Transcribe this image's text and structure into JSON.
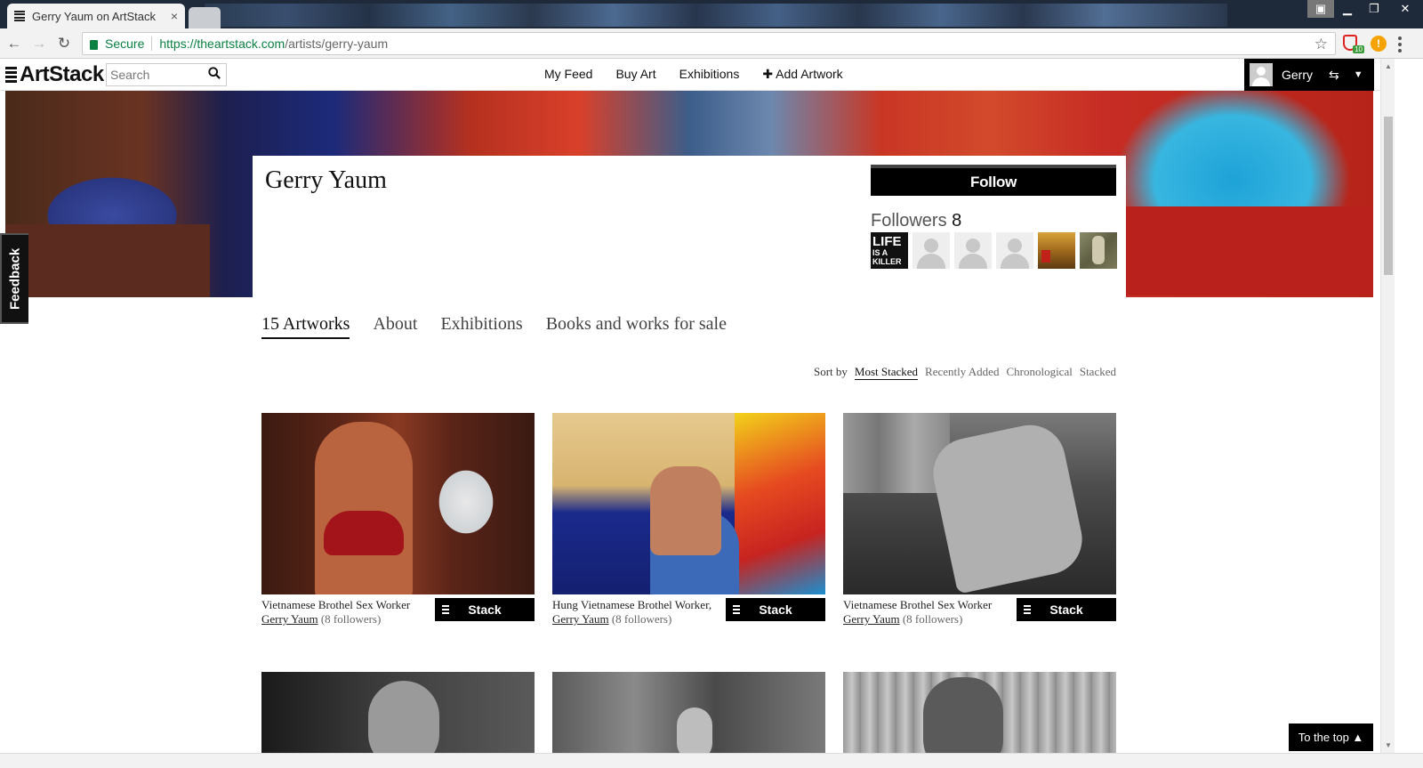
{
  "browser": {
    "tab_title": "Gerry Yaum on ArtStack",
    "tab_close": "×",
    "secure_label": "Secure",
    "url_host": "https://theartstack.com",
    "url_path": "/artists/gerry-yaum",
    "extension_badge": "10",
    "extension_alert": "!"
  },
  "site": {
    "logo": "ArtStack",
    "search_placeholder": "Search",
    "nav": {
      "my_feed": "My Feed",
      "buy_art": "Buy Art",
      "exhibitions": "Exhibitions",
      "add_artwork": "✚ Add Artwork"
    },
    "user": {
      "name": "Gerry",
      "swap_icon": "⇆",
      "caret": "▼"
    }
  },
  "profile": {
    "artist_name": "Gerry Yaum",
    "follow_label": "Follow",
    "followers_label": "Followers",
    "followers_count": "8",
    "follower_thumb_text": {
      "line1": "LIFE",
      "line2": "IS A KILLER"
    }
  },
  "feedback_label": "Feedback",
  "tabs": {
    "artworks": "15 Artworks",
    "about": "About",
    "exhibitions": "Exhibitions",
    "books": "Books and works for sale"
  },
  "sort": {
    "label": "Sort by",
    "options": [
      "Most Stacked",
      "Recently Added",
      "Chronological",
      "Stacked"
    ],
    "active": "Most Stacked"
  },
  "artworks": [
    {
      "title": "Vietnamese Brothel Sex Worker",
      "artist": "Gerry Yaum",
      "followers": "(8 followers)",
      "stack_label": "Stack"
    },
    {
      "title": "Hung Vietnamese Brothel Worker,",
      "artist": "Gerry Yaum",
      "followers": "(8 followers)",
      "stack_label": "Stack"
    },
    {
      "title": "Vietnamese Brothel Sex Worker",
      "artist": "Gerry Yaum",
      "followers": "(8 followers)",
      "stack_label": "Stack"
    }
  ],
  "to_top_label": "To the top ▲"
}
